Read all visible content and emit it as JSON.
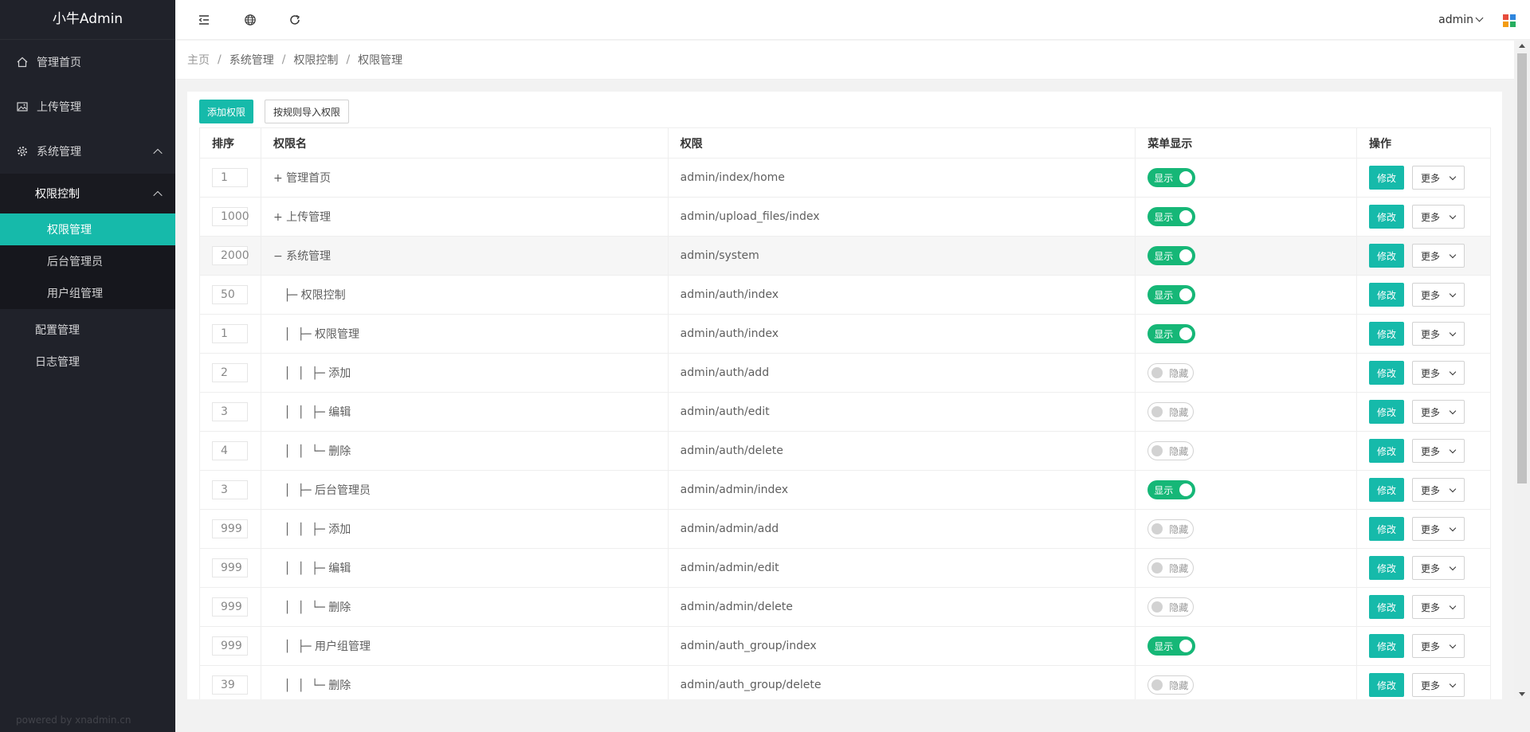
{
  "app": {
    "title": "小牛Admin",
    "powered": "powered by xnadmin.cn"
  },
  "sidebar": {
    "items": [
      {
        "label": "管理首页",
        "icon": "home-icon"
      },
      {
        "label": "上传管理",
        "icon": "image-icon"
      },
      {
        "label": "系统管理",
        "icon": "gear-icon"
      }
    ],
    "submenu": {
      "label": "权限控制",
      "items": [
        "权限管理",
        "后台管理员",
        "用户组管理"
      ]
    },
    "more": [
      "配置管理",
      "日志管理"
    ]
  },
  "header": {
    "user": "admin",
    "icons": [
      "menu-fold-icon",
      "globe-icon",
      "refresh-icon",
      "apps-icon"
    ]
  },
  "breadcrumb": [
    "主页",
    "系统管理",
    "权限控制",
    "权限管理"
  ],
  "toolbar": {
    "add": "添加权限",
    "import": "按规则导入权限"
  },
  "table": {
    "headers": [
      "排序",
      "权限名",
      "权限",
      "菜单显示",
      "操作"
    ],
    "edit_label": "修改",
    "more_label": "更多",
    "rows": [
      {
        "sort": "1",
        "name": "+ 管理首页",
        "path": "admin/index/home",
        "switch": "显示",
        "on": true
      },
      {
        "sort": "1000",
        "name": "+ 上传管理",
        "path": "admin/upload_files/index",
        "switch": "显示",
        "on": true
      },
      {
        "sort": "2000",
        "name": "− 系统管理",
        "path": "admin/system",
        "switch": "显示",
        "on": true
      },
      {
        "sort": "50",
        "name": "   ├─ 权限控制",
        "path": "admin/auth/index",
        "switch": "显示",
        "on": true
      },
      {
        "sort": "1",
        "name": "   │  ├─ 权限管理",
        "path": "admin/auth/index",
        "switch": "显示",
        "on": true
      },
      {
        "sort": "2",
        "name": "   │  │  ├─ 添加",
        "path": "admin/auth/add",
        "switch": "隐藏",
        "on": false
      },
      {
        "sort": "3",
        "name": "   │  │  ├─ 编辑",
        "path": "admin/auth/edit",
        "switch": "隐藏",
        "on": false
      },
      {
        "sort": "4",
        "name": "   │  │  └─ 删除",
        "path": "admin/auth/delete",
        "switch": "隐藏",
        "on": false
      },
      {
        "sort": "3",
        "name": "   │  ├─ 后台管理员",
        "path": "admin/admin/index",
        "switch": "显示",
        "on": true
      },
      {
        "sort": "999",
        "name": "   │  │  ├─ 添加",
        "path": "admin/admin/add",
        "switch": "隐藏",
        "on": false
      },
      {
        "sort": "999",
        "name": "   │  │  ├─ 编辑",
        "path": "admin/admin/edit",
        "switch": "隐藏",
        "on": false
      },
      {
        "sort": "999",
        "name": "   │  │  └─ 删除",
        "path": "admin/admin/delete",
        "switch": "隐藏",
        "on": false
      },
      {
        "sort": "999",
        "name": "   │  ├─ 用户组管理",
        "path": "admin/auth_group/index",
        "switch": "显示",
        "on": true
      },
      {
        "sort": "39",
        "name": "   │  │  └─ 删除",
        "path": "admin/auth_group/delete",
        "switch": "隐藏",
        "on": false
      }
    ]
  },
  "colors": {
    "accent": "#16baaa",
    "switch_on": "#16b777",
    "sidebar": "#20222a"
  }
}
